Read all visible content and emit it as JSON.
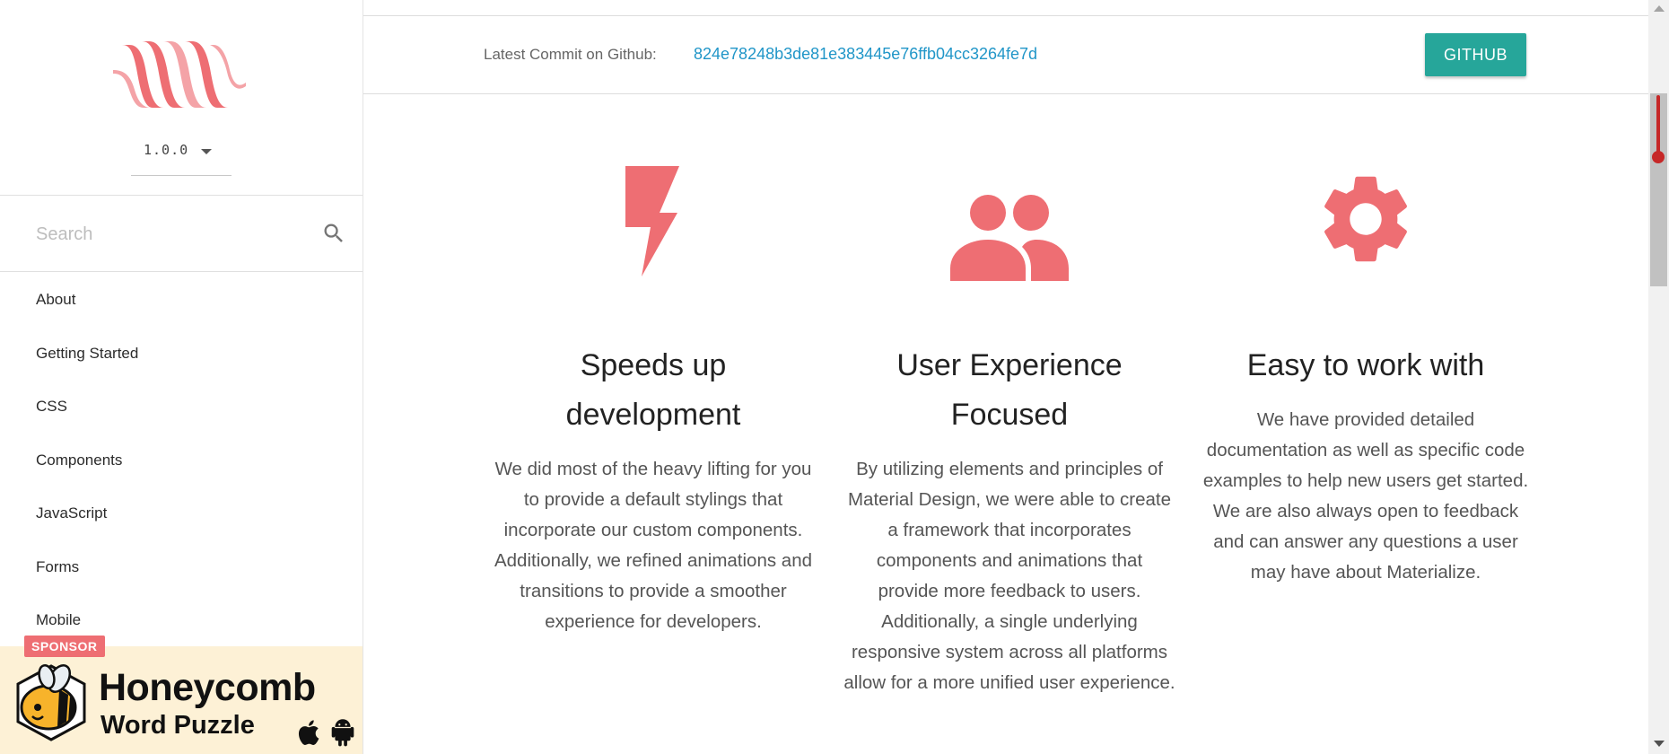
{
  "sidebar": {
    "version": "1.0.0",
    "search_placeholder": "Search",
    "nav": [
      "About",
      "Getting Started",
      "CSS",
      "Components",
      "JavaScript",
      "Forms",
      "Mobile"
    ],
    "sponsor": {
      "badge": "SPONSOR",
      "title": "Honeycomb",
      "subtitle": "Word Puzzle"
    }
  },
  "commit": {
    "label": "Latest Commit on Github:",
    "hash": "824e78248b3de81e383445e76ffb04cc3264fe7d",
    "button": "GITHUB"
  },
  "features": [
    {
      "icon": "flash-icon",
      "title_line1": "Speeds up",
      "title_line2": "development",
      "lines": [
        "We did most of the heavy lifting for you",
        "to provide a default stylings that",
        "incorporate our custom components.",
        "Additionally, we refined animations and",
        "transitions to provide a smoother",
        "experience for developers."
      ]
    },
    {
      "icon": "group-icon",
      "title_line1": "User Experience",
      "title_line2": "Focused",
      "lines": [
        "By utilizing elements and principles of",
        "Material Design, we were able to create",
        "a framework that incorporates",
        "components and animations that",
        "provide more feedback to users.",
        "Additionally, a single underlying",
        "responsive system across all platforms",
        "allow for a more unified user experience."
      ]
    },
    {
      "icon": "settings-icon",
      "title_line1": "Easy to work with",
      "lines": [
        "We have provided detailed",
        "documentation as well as specific code",
        "examples to help new users get started.",
        "We are also always open to feedback",
        "and can answer any questions a user",
        "may have about Materialize."
      ]
    }
  ],
  "colors": {
    "accent": "#ee6e73",
    "button": "#26a69a",
    "link": "#2196c8",
    "sponsor_bg": "#fdf1d6"
  }
}
